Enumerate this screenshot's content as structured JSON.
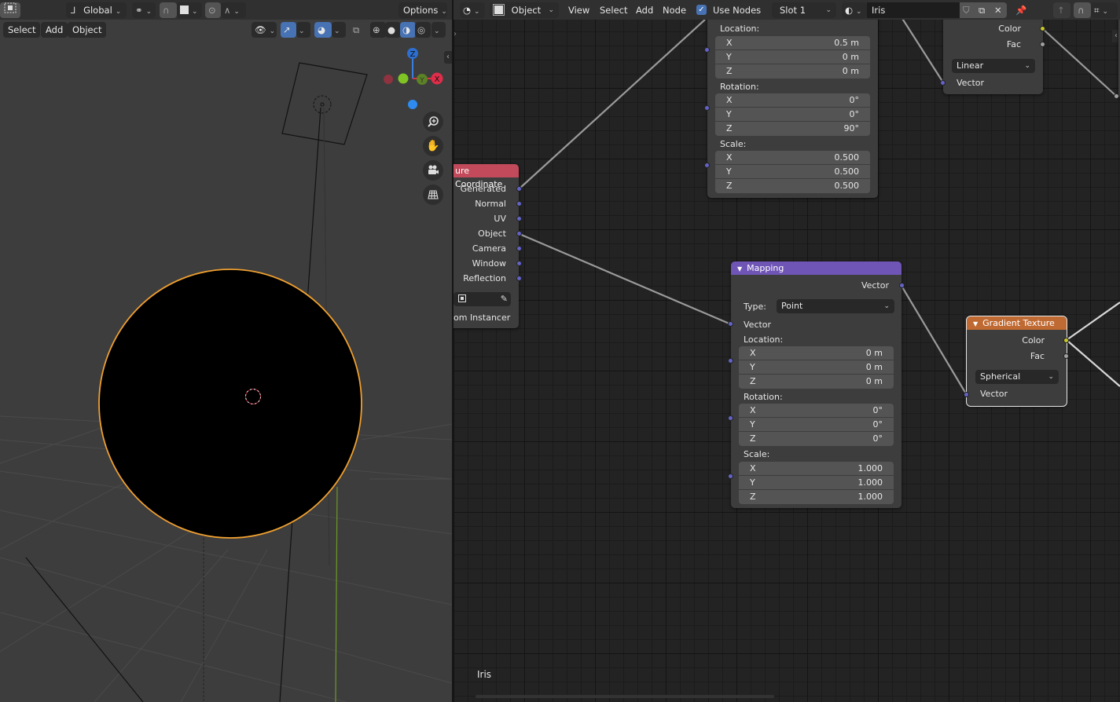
{
  "viewport": {
    "header": {
      "transform_orientation": "Global",
      "options_label": "Options"
    },
    "menu": [
      "Select",
      "Add",
      "Object"
    ],
    "gizmo": {
      "z": "Z",
      "x": "X",
      "y": "Y"
    },
    "nav_buttons": [
      "zoom",
      "pan",
      "camera",
      "ortho"
    ]
  },
  "node_editor": {
    "header": {
      "mode": "Object",
      "menu": [
        "View",
        "Select",
        "Add",
        "Node"
      ],
      "use_nodes_label": "Use Nodes",
      "use_nodes_checked": true,
      "slot": "Slot 1",
      "material_name": "Iris"
    },
    "material_label": "Iris",
    "colors": {
      "texture_header": "#c24a5a",
      "mapping_header": "#6f55b5",
      "gradient_header": "#c06a33",
      "vector_socket": "#6363c7",
      "color_socket": "#c7c729",
      "fac_socket": "#a1a1a1"
    },
    "texture_coordinate": {
      "title": "ure Coordinate",
      "outputs": [
        "Generated",
        "Normal",
        "UV",
        "Object",
        "Camera",
        "Window",
        "Reflection"
      ],
      "from_instancer": "om Instancer"
    },
    "mapping_top": {
      "location_label": "Location:",
      "location": [
        {
          "k": "X",
          "v": "0.5 m"
        },
        {
          "k": "Y",
          "v": "0 m"
        },
        {
          "k": "Z",
          "v": "0 m"
        }
      ],
      "rotation_label": "Rotation:",
      "rotation": [
        {
          "k": "X",
          "v": "0°"
        },
        {
          "k": "Y",
          "v": "0°"
        },
        {
          "k": "Z",
          "v": "90°"
        }
      ],
      "scale_label": "Scale:",
      "scale": [
        {
          "k": "X",
          "v": "0.500"
        },
        {
          "k": "Y",
          "v": "0.500"
        },
        {
          "k": "Z",
          "v": "0.500"
        }
      ]
    },
    "gradient_top": {
      "color_label": "Color",
      "fac_label": "Fac",
      "type": "Linear",
      "vector_label": "Vector"
    },
    "mapping": {
      "title": "Mapping",
      "output_vector": "Vector",
      "type_label": "Type:",
      "type_value": "Point",
      "input_vector": "Vector",
      "location_label": "Location:",
      "location": [
        {
          "k": "X",
          "v": "0 m"
        },
        {
          "k": "Y",
          "v": "0 m"
        },
        {
          "k": "Z",
          "v": "0 m"
        }
      ],
      "rotation_label": "Rotation:",
      "rotation": [
        {
          "k": "X",
          "v": "0°"
        },
        {
          "k": "Y",
          "v": "0°"
        },
        {
          "k": "Z",
          "v": "0°"
        }
      ],
      "scale_label": "Scale:",
      "scale": [
        {
          "k": "X",
          "v": "1.000"
        },
        {
          "k": "Y",
          "v": "1.000"
        },
        {
          "k": "Z",
          "v": "1.000"
        }
      ]
    },
    "gradient_texture": {
      "title": "Gradient Texture",
      "color_label": "Color",
      "fac_label": "Fac",
      "type": "Spherical",
      "vector_label": "Vector"
    }
  }
}
